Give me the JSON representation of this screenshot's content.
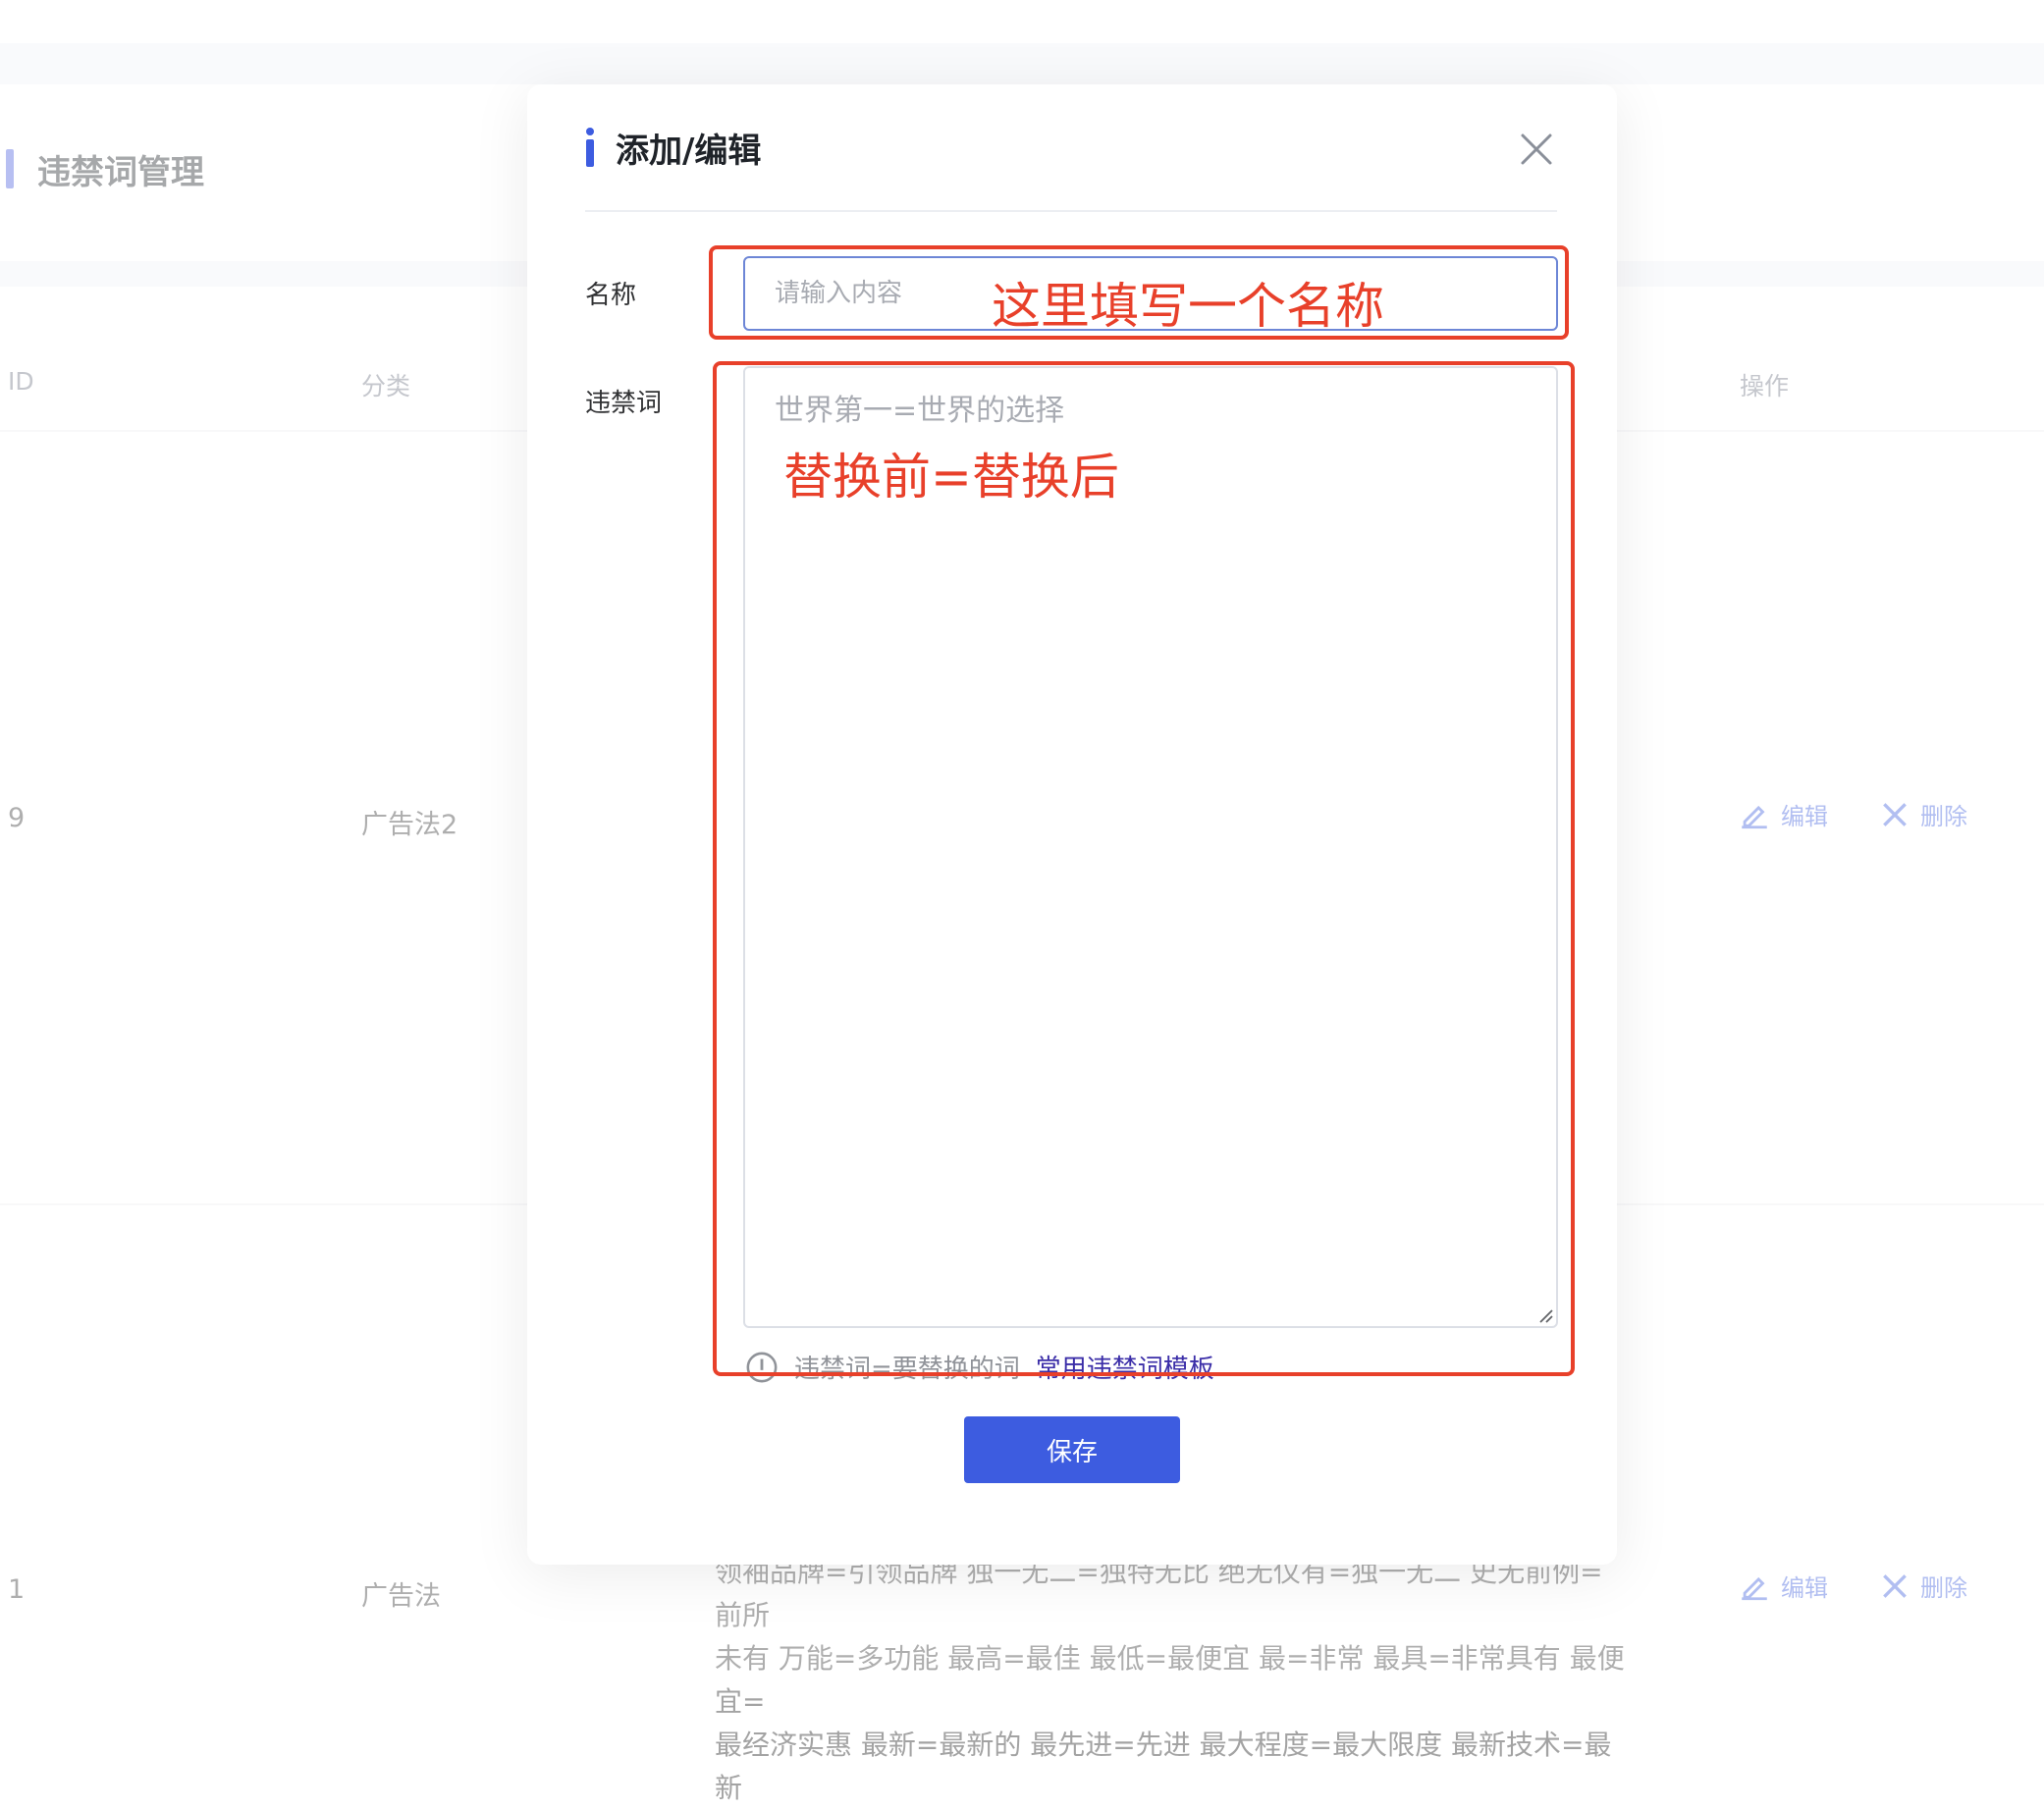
{
  "background": {
    "page_title": "违禁词管理",
    "table": {
      "headers": {
        "id": "ID",
        "category": "分类",
        "action": "操作"
      },
      "rows": [
        {
          "id": "9",
          "category": "广告法2",
          "edit": "编辑",
          "delete": "删除"
        },
        {
          "id": "1",
          "category": "广告法",
          "edit": "编辑",
          "delete": "删除",
          "content_lines": [
            "领袖品牌=引领品牌 独一无二=独特无比 绝无仅有=独一无二 史无前例=前所",
            "未有 万能=多功能 最高=最佳 最低=最便宜 最=非常 最具=非常具有 最便宜=",
            "最经济实惠 最新=最新的 最先进=先进 最大程度=最大限度 最新技术=最新"
          ]
        }
      ]
    }
  },
  "dialog": {
    "title": "添加/编辑",
    "name_label": "名称",
    "name_placeholder": "请输入内容",
    "name_value": "",
    "words_label": "违禁词",
    "words_placeholder": "世界第一=世界的选择",
    "words_value": "",
    "hint_text": "违禁词=要替换的词",
    "hint_link": "常用违禁词模板",
    "save_label": "保存"
  },
  "annotations": {
    "name_note": "这里填写一个名称",
    "words_note": "替换前=替换后"
  },
  "colors": {
    "accent": "#3d5ce0",
    "annotation_red": "#e8402a",
    "link": "#3b2ea8"
  }
}
